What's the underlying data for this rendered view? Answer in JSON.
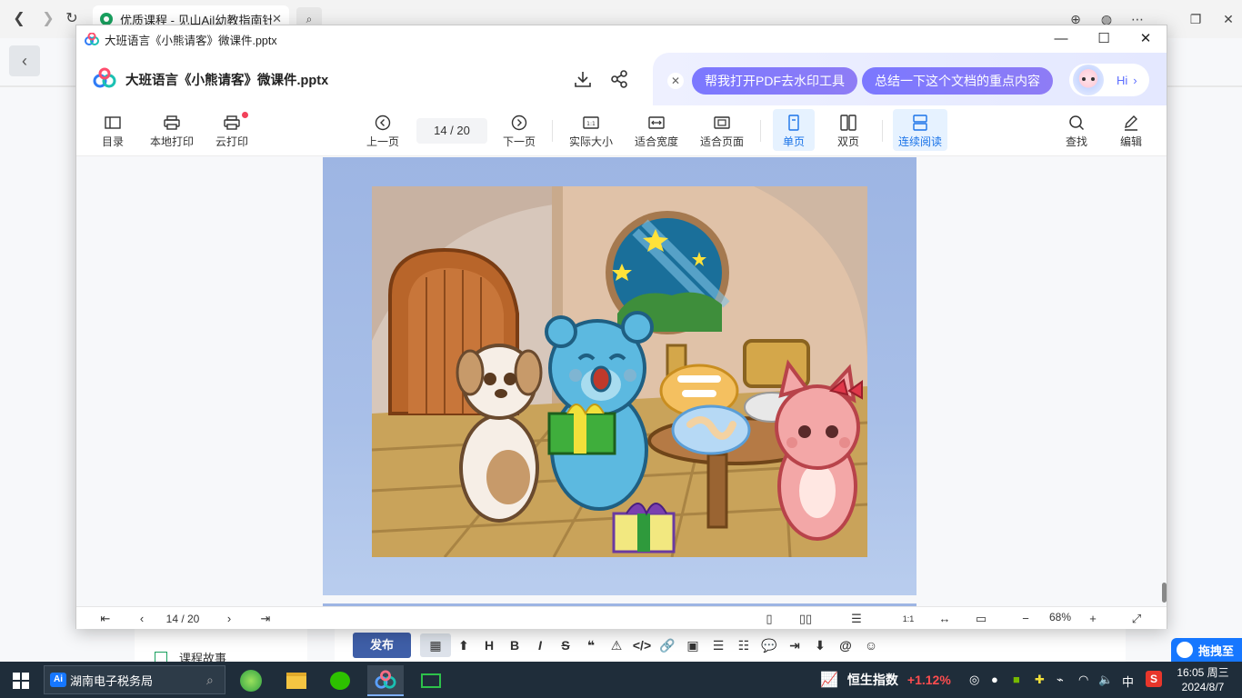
{
  "browser": {
    "tab_title": "优质课程 - 见山Ai|幼教指南针",
    "tab_close": "✕"
  },
  "background_page": {
    "course_story_label": "课程故事",
    "publish_label": "发布",
    "toolbar_items": [
      "H",
      "B",
      "I",
      "S",
      "❝",
      "⚠",
      "</>",
      "🔗",
      "▣",
      "☰",
      "☷",
      "💬",
      "⇥",
      "⬇",
      "@",
      "☺"
    ],
    "float_badge": "拖拽至"
  },
  "window": {
    "title": "大班语言《小熊请客》微课件.pptx"
  },
  "header": {
    "doc_title": "大班语言《小熊请客》微课件.pptx"
  },
  "ai_bar": {
    "chip1": "帮我打开PDF去水印工具",
    "chip2": "总结一下这个文档的重点内容",
    "hi_label": "Hi"
  },
  "toolbar": {
    "toc": "目录",
    "local_print": "本地打印",
    "cloud_print": "云打印",
    "prev_page": "上一页",
    "next_page": "下一页",
    "actual_size": "实际大小",
    "fit_width": "适合宽度",
    "fit_page": "适合页面",
    "single_page": "单页",
    "double_page": "双页",
    "continuous": "连续阅读",
    "find": "查找",
    "edit": "编辑"
  },
  "pager": {
    "current": 14,
    "total": 20,
    "display": "14 / 20"
  },
  "statusbar": {
    "page_display": "14 / 20",
    "zoom": "68%"
  },
  "taskbar": {
    "search_text": "湖南电子税务局",
    "stock_name": "恒生指数",
    "stock_change": "+1.12%",
    "ime": "中",
    "time": "16:05 周三",
    "date": "2024/8/7"
  },
  "colors": {
    "accent": "#1a73e8",
    "ai_chip": "#7b78ff",
    "slide_bg": "#9db5e3",
    "taskbar": "#1f2d3a",
    "stock_up": "#ff4d4f"
  }
}
